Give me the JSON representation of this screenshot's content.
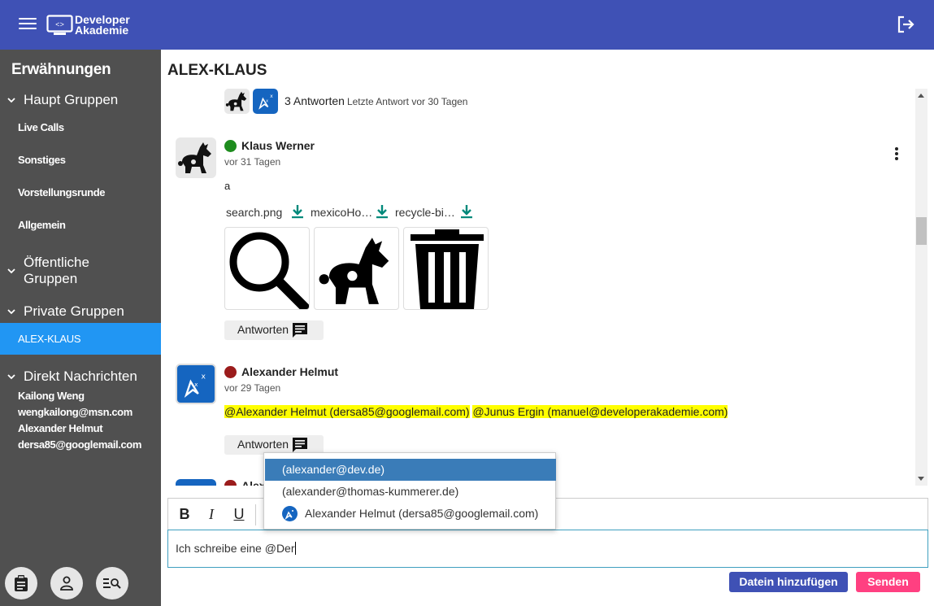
{
  "app": {
    "logo_line1": "Developer",
    "logo_line2": "Akademie",
    "colors": {
      "topbar": "#3f51b5",
      "sidebar": "#505050",
      "active": "#2196f3",
      "send": "#ff4081",
      "highlight": "#ffff00"
    }
  },
  "sidebar": {
    "title": "Erwähnungen",
    "groups": {
      "main": {
        "label": "Haupt Gruppen",
        "items": [
          "Live Calls",
          "Sonstiges",
          "Vorstellungsrunde",
          "Allgemein"
        ]
      },
      "public": {
        "label_line1": "Öffentliche",
        "label_line2": "Gruppen"
      },
      "private": {
        "label": "Private Gruppen",
        "items": [
          "ALEX-KLAUS"
        ]
      },
      "direct": {
        "label": "Direkt Nachrichten",
        "items": [
          "Kailong Weng",
          "wengkailong@msn.com",
          "Alexander Helmut",
          "dersa85@googlemail.com"
        ]
      }
    },
    "bottom_buttons": [
      "clipboard-icon",
      "person-icon",
      "search-list-icon"
    ]
  },
  "channel": {
    "title": "ALEX-KLAUS",
    "thread": {
      "replies": "3 Antworten",
      "last_reply": "Letzte Antwort vor 30 Tagen"
    },
    "messages": [
      {
        "author": "Klaus Werner",
        "status_color": "#1e8c1e",
        "time": "vor 31 Tagen",
        "text": "a",
        "files": [
          "search.png",
          "mexicoHo…",
          "recycle-bi…"
        ],
        "reply_label": "Antworten"
      },
      {
        "author": "Alexander Helmut",
        "status_color": "#9b1c1c",
        "time": "vor 29 Tagen",
        "mention1": "@Alexander Helmut (dersa85@googlemail.com)",
        "mention2": "@Junus Ergin (manuel@developerakademie.com)",
        "reply_label": "Antworten"
      }
    ],
    "partial_author": "Alex"
  },
  "editor": {
    "bold": "B",
    "italic": "I",
    "underline": "U",
    "input_value": "Ich schreibe eine @Der",
    "add_files_label": "Datein hinzufügen",
    "send_label": "Senden"
  },
  "autocomplete": {
    "items": [
      "(alexander@dev.de)",
      "(alexander@thomas-kummerer.de)",
      "Alexander Helmut (dersa85@googlemail.com)"
    ],
    "selected_index": 0
  }
}
